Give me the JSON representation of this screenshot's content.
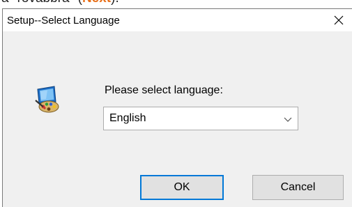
{
  "top_fragment": {
    "text": "a \"rövabbra\" (",
    "accent": "Next",
    "tail": ")."
  },
  "dialog": {
    "title": "Setup--Select Language",
    "close_glyph": "×",
    "prompt": "Please select language:",
    "language_select": {
      "selected": "English"
    },
    "buttons": {
      "ok": "OK",
      "cancel": "Cancel"
    },
    "icons": {
      "app": "computer-with-palette-icon",
      "close": "close-icon",
      "dropdown": "chevron-down-icon"
    }
  },
  "colors": {
    "accent_text": "#e8701a",
    "focus_border": "#0078d7",
    "dialog_bg": "#f0f0f0"
  }
}
